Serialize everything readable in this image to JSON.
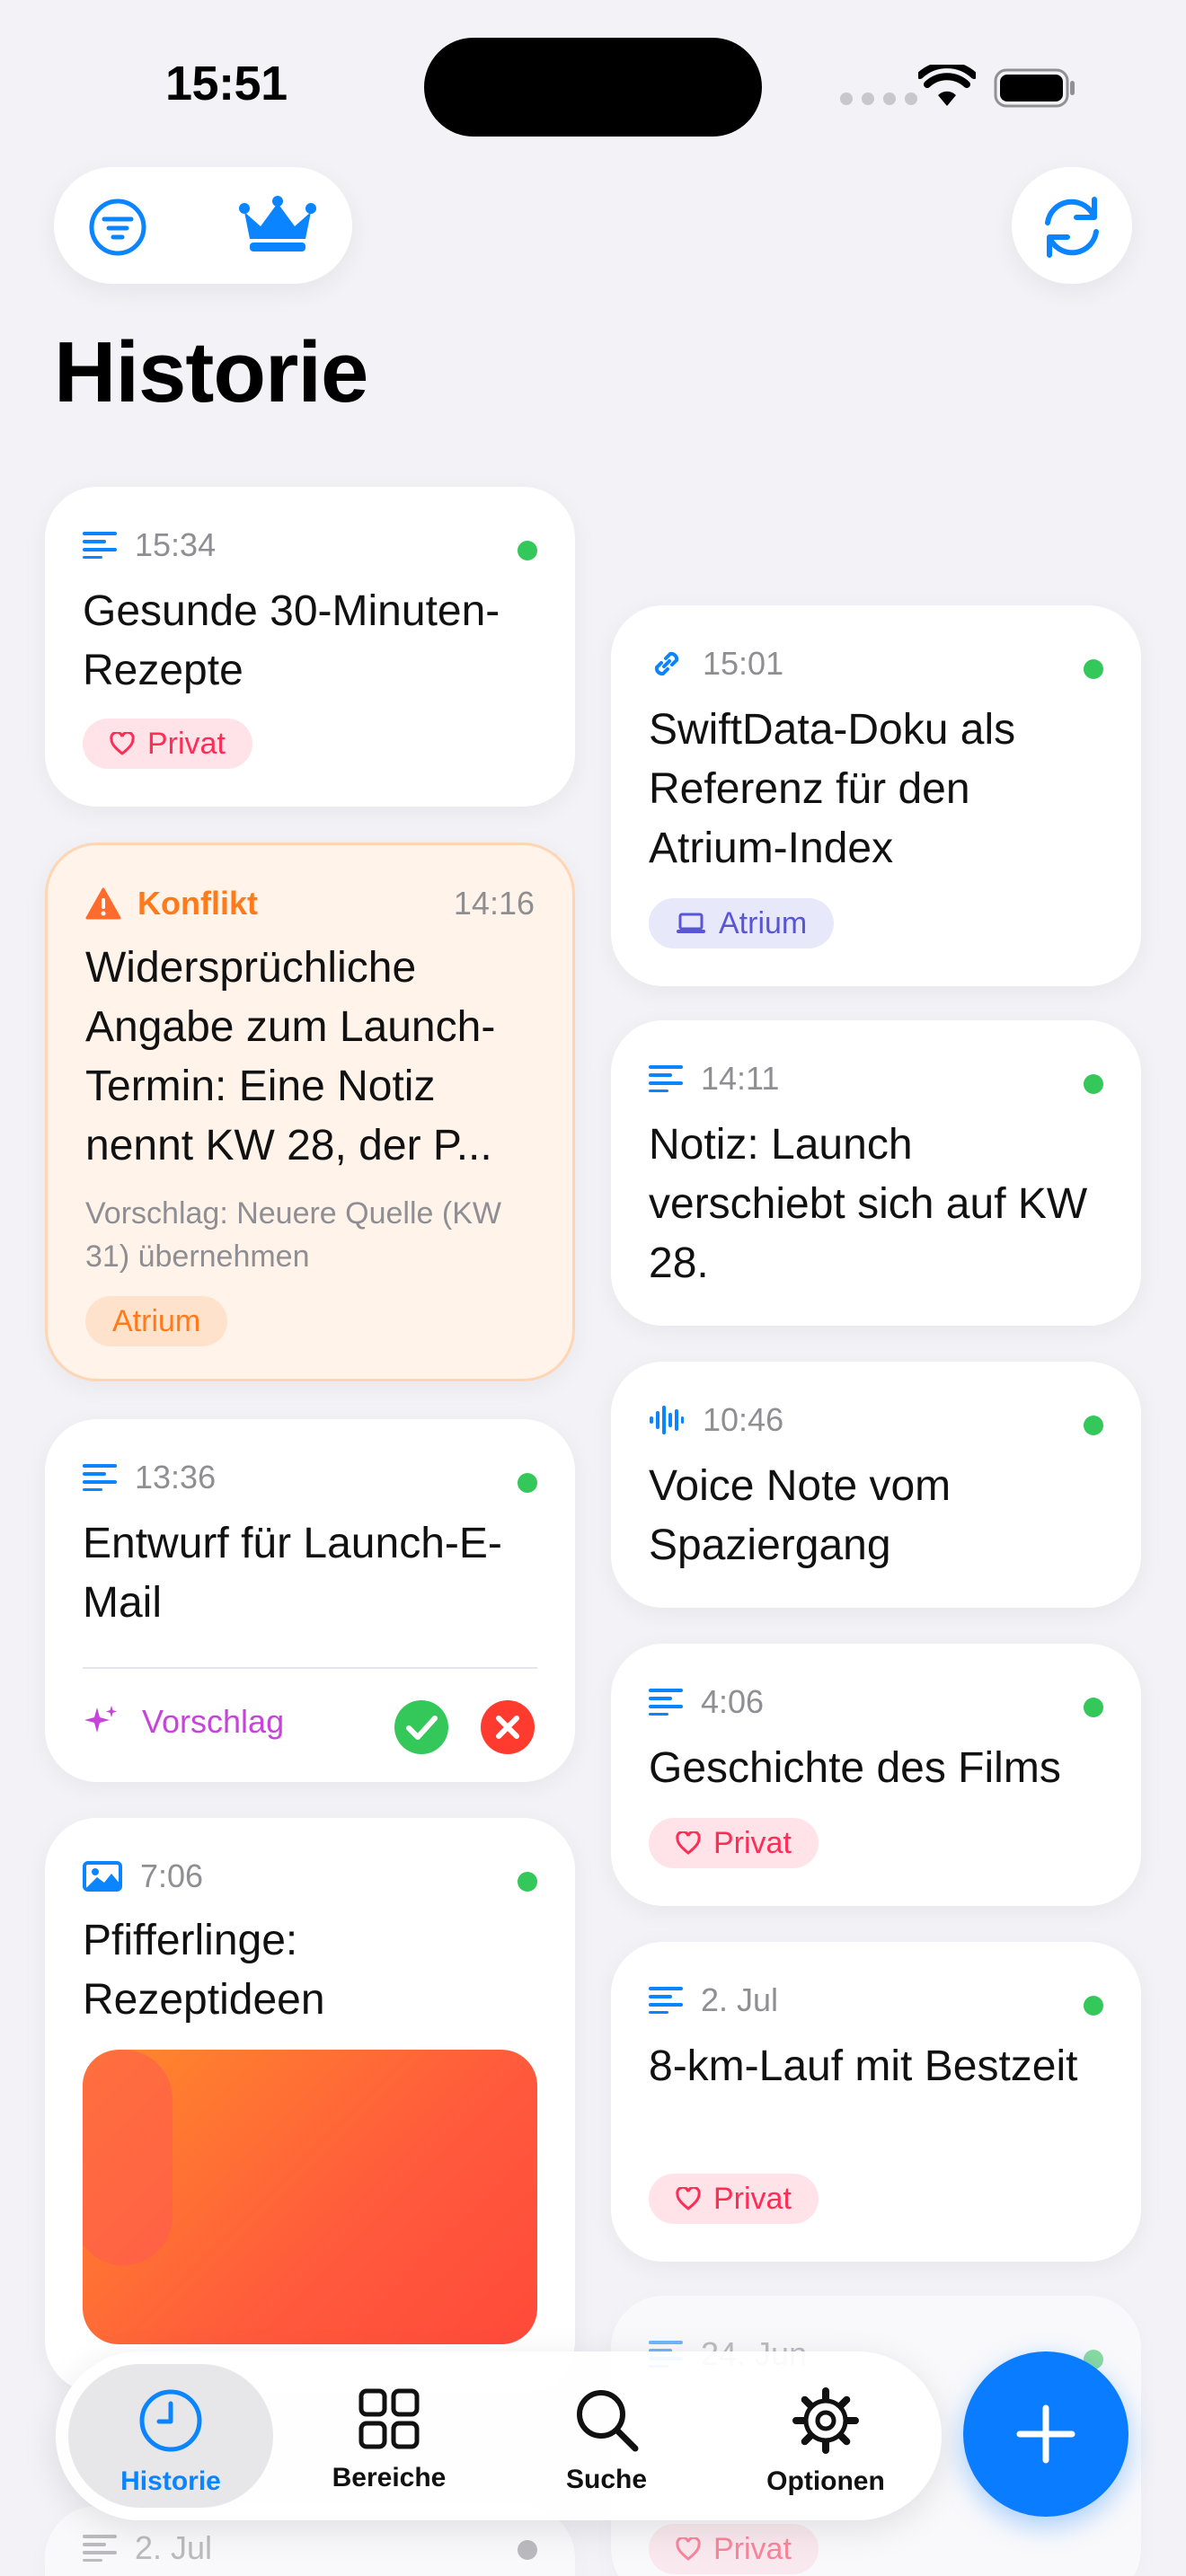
{
  "status": {
    "time": "15:51"
  },
  "header": {
    "title": "Historie"
  },
  "colors": {
    "accent": "#0a84ff",
    "green": "#34c759",
    "red": "#ff3b30",
    "conflict": "#ff7a1a",
    "pink": "#ff2d55",
    "purple": "#5856d6",
    "magenta": "#c644d9"
  },
  "left_column": [
    {
      "icon": "text-lines-icon",
      "time": "15:34",
      "title": "Gesunde 30-Minuten-Rezepte",
      "tag": "Privat"
    },
    {
      "icon": "warning-icon",
      "label": "Konflikt",
      "time": "14:16",
      "title": "Widersprüchliche Angabe zum Launch-Termin: Eine Notiz nennt KW 28, der P...",
      "suggestion": "Vorschlag: Neuere Quelle (KW 31) übernehmen",
      "tag": "Atrium"
    },
    {
      "icon": "text-lines-icon",
      "time": "13:36",
      "title": "Entwurf für Launch-E-Mail",
      "action_label": "Vorschlag"
    },
    {
      "icon": "photo-icon",
      "time": "7:06",
      "title": "Pfifferlinge: Rezeptideen"
    },
    {
      "icon": "text-lines-icon",
      "time": "2. Jul"
    }
  ],
  "right_column": [
    {
      "icon": "link-icon",
      "time": "15:01",
      "title": "SwiftData-Doku als Referenz für den Atrium-Index",
      "tag": "Atrium"
    },
    {
      "icon": "text-lines-icon",
      "time": "14:11",
      "title": "Notiz: Launch verschiebt sich auf KW 28."
    },
    {
      "icon": "waveform-icon",
      "time": "10:46",
      "title": "Voice Note vom Spaziergang"
    },
    {
      "icon": "text-lines-icon",
      "time": "4:06",
      "title": "Geschichte des Films",
      "tag": "Privat"
    },
    {
      "icon": "text-lines-icon",
      "time": "2. Jul",
      "title": "8-km-Lauf mit Bestzeit",
      "tag": "Privat"
    },
    {
      "icon": "text-lines-icon",
      "time": "24. Jun",
      "tag": "Privat"
    }
  ],
  "tabbar": {
    "tabs": [
      {
        "label": "Historie",
        "icon": "clock-icon",
        "active": true
      },
      {
        "label": "Bereiche",
        "icon": "grid-icon"
      },
      {
        "label": "Suche",
        "icon": "magnifier-icon"
      },
      {
        "label": "Optionen",
        "icon": "gear-icon"
      }
    ]
  }
}
